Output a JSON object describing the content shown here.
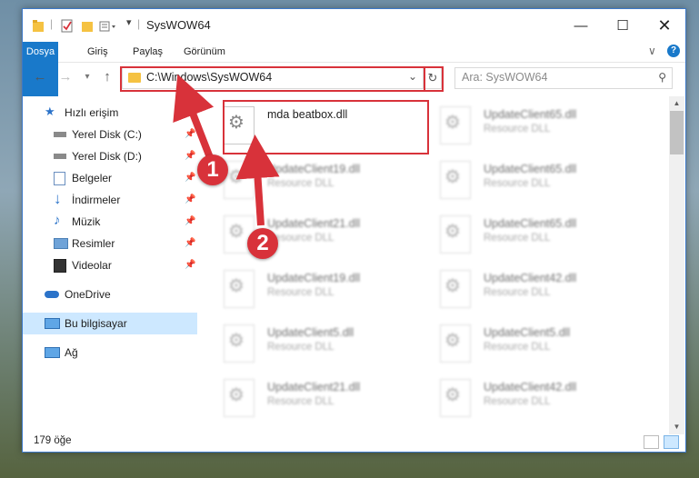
{
  "window": {
    "title": "SysWOW64"
  },
  "ribbon": {
    "tabs": [
      "Dosya",
      "Giriş",
      "Paylaş",
      "Görünüm"
    ]
  },
  "address": {
    "path": "C:\\Windows\\SysWOW64"
  },
  "search": {
    "placeholder": "Ara: SysWOW64"
  },
  "sidebar": {
    "items": [
      {
        "label": "Hızlı erişim",
        "icon": "star-icon"
      },
      {
        "label": "Yerel Disk (C:)",
        "icon": "drive-icon",
        "pinned": true
      },
      {
        "label": "Yerel Disk (D:)",
        "icon": "drive-icon",
        "pinned": true
      },
      {
        "label": "Belgeler",
        "icon": "documents-icon",
        "pinned": true
      },
      {
        "label": "İndirmeler",
        "icon": "download-icon",
        "pinned": true
      },
      {
        "label": "Müzik",
        "icon": "music-icon",
        "pinned": true
      },
      {
        "label": "Resimler",
        "icon": "pictures-icon",
        "pinned": true
      },
      {
        "label": "Videolar",
        "icon": "video-icon",
        "pinned": true
      },
      {
        "label": "OneDrive",
        "icon": "cloud-icon"
      },
      {
        "label": "Bu bilgisayar",
        "icon": "computer-icon",
        "selected": true
      },
      {
        "label": "Ağ",
        "icon": "network-icon"
      }
    ]
  },
  "files": [
    {
      "name": "mda beatbox.dll",
      "type": ""
    },
    {
      "name": "UpdateClient65.dll",
      "type": "Resource DLL"
    },
    {
      "name": "UpdateClient19.dll",
      "type": "Resource DLL"
    },
    {
      "name": "UpdateClient65.dll",
      "type": "Resource DLL"
    },
    {
      "name": "UpdateClient21.dll",
      "type": "Resource DLL"
    },
    {
      "name": "UpdateClient65.dll",
      "type": "Resource DLL"
    },
    {
      "name": "UpdateClient19.dll",
      "type": "Resource DLL"
    },
    {
      "name": "UpdateClient42.dll",
      "type": "Resource DLL"
    },
    {
      "name": "UpdateClient5.dll",
      "type": "Resource DLL"
    },
    {
      "name": "UpdateClient5.dll",
      "type": "Resource DLL"
    },
    {
      "name": "UpdateClient21.dll",
      "type": "Resource DLL"
    },
    {
      "name": "UpdateClient42.dll",
      "type": "Resource DLL"
    }
  ],
  "status": {
    "count": "179 öğe"
  },
  "callouts": [
    "1",
    "2"
  ],
  "colors": {
    "accent": "#1979ca",
    "highlight": "#d8323a",
    "selection": "#cde8ff"
  }
}
